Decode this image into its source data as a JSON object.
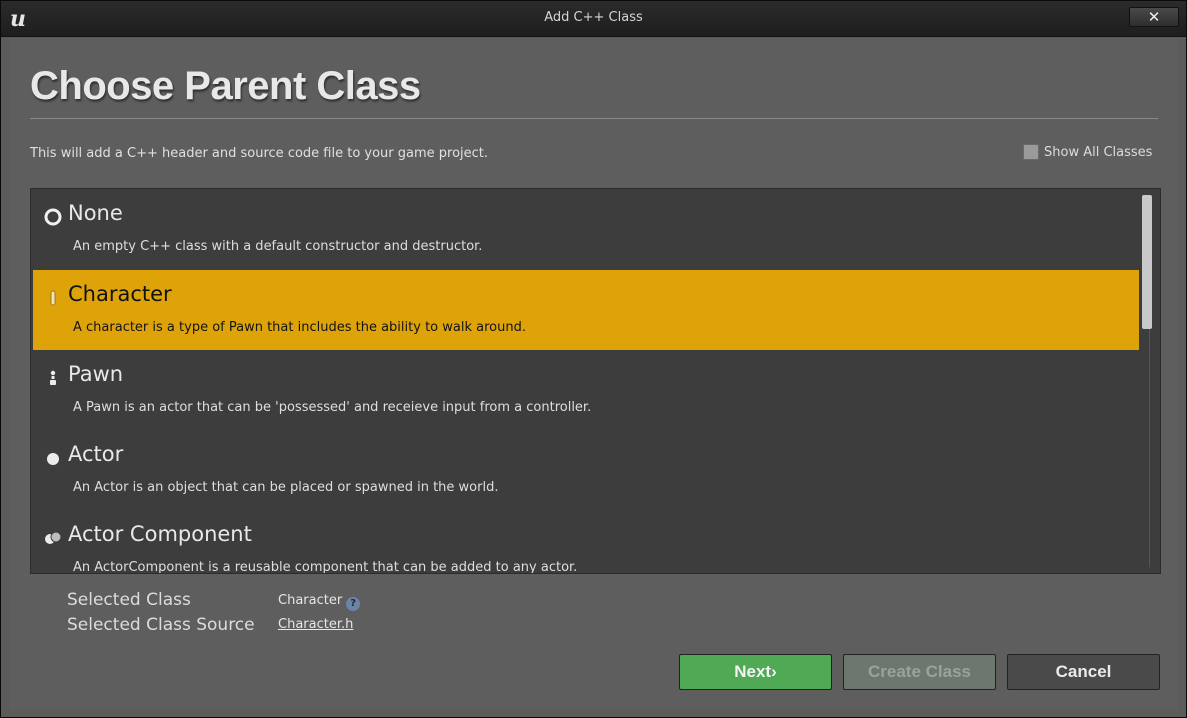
{
  "window": {
    "title": "Add C++ Class",
    "close_label": "✕"
  },
  "header": {
    "title": "Choose Parent Class",
    "description": "This will add a C++ header and source code file to your game project.",
    "show_all_label": "Show All Classes",
    "show_all_checked": false
  },
  "classes": [
    {
      "name": "None",
      "description": "An empty C++ class with a default constructor and destructor.",
      "icon": "empty-circle-icon",
      "selected": false
    },
    {
      "name": "Character",
      "description": "A character is a type of Pawn that includes the ability to walk around.",
      "icon": "character-icon",
      "selected": true
    },
    {
      "name": "Pawn",
      "description": "A Pawn is an actor that can be 'possessed' and receieve input from a controller.",
      "icon": "pawn-icon",
      "selected": false
    },
    {
      "name": "Actor",
      "description": "An Actor is an object that can be placed or spawned in the world.",
      "icon": "actor-icon",
      "selected": false
    },
    {
      "name": "Actor Component",
      "description": "An ActorComponent is a reusable component that can be added to any actor.",
      "icon": "actor-component-icon",
      "selected": false
    }
  ],
  "selection": {
    "class_label": "Selected Class",
    "class_value": "Character",
    "source_label": "Selected Class Source",
    "source_value": "Character.h"
  },
  "buttons": {
    "next": "Next",
    "next_arrow": "›",
    "create": "Create Class",
    "cancel": "Cancel"
  },
  "colors": {
    "selected_row": "#dea309",
    "next_button": "#4fa955"
  }
}
